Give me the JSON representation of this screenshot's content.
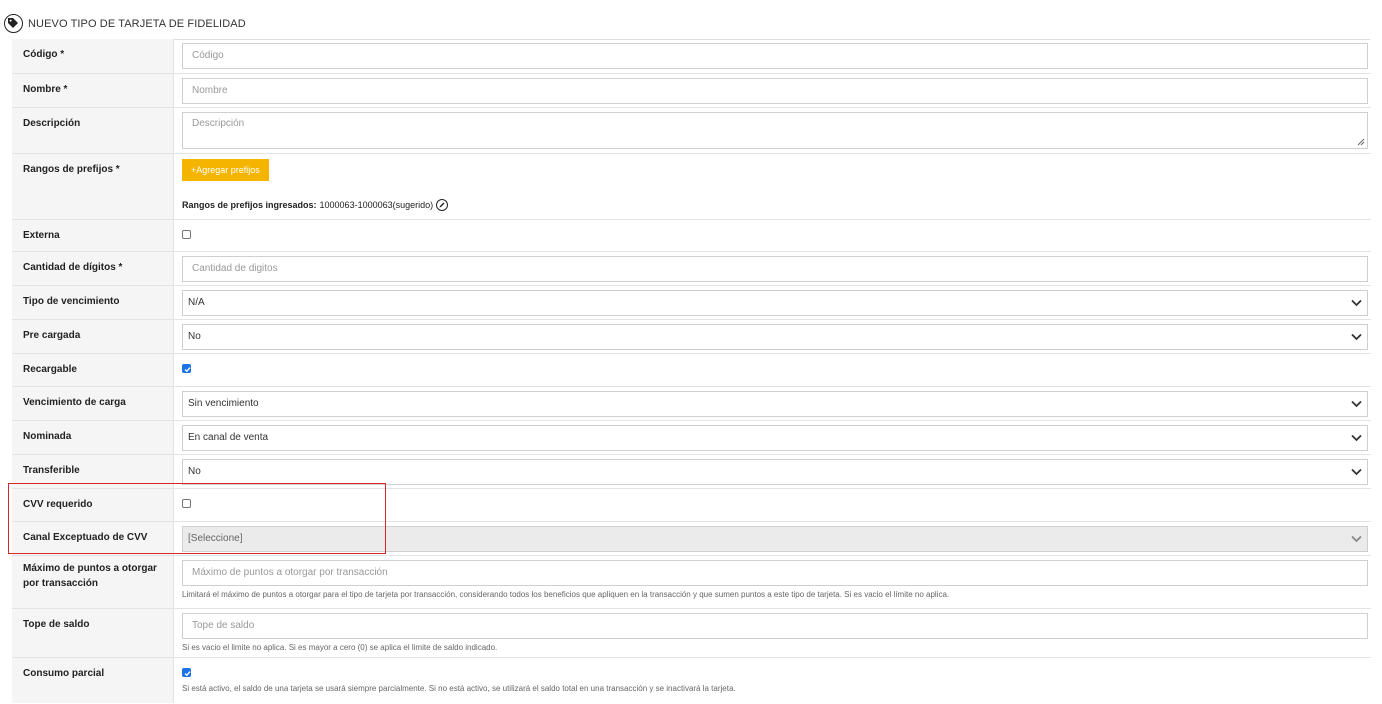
{
  "header": {
    "title": "NUEVO TIPO DE TARJETA DE FIDELIDAD",
    "icon": "tag-icon"
  },
  "form": {
    "codigo": {
      "label": "Código *",
      "placeholder": "Código"
    },
    "nombre": {
      "label": "Nombre *",
      "placeholder": "Nombre"
    },
    "descripcion": {
      "label": "Descripción",
      "placeholder": "Descripción"
    },
    "rangos": {
      "label": "Rangos de prefijos *",
      "button": "+Agregar prefijos",
      "ingresados_label": "Rangos de prefijos ingresados:",
      "ingresados_value": "1000063-1000063(sugerido)"
    },
    "externa": {
      "label": "Externa",
      "checked": false
    },
    "cantidad_digitos": {
      "label": "Cantidad de dígitos *",
      "placeholder": "Cantidad de digitos"
    },
    "tipo_vencimiento": {
      "label": "Tipo de vencimiento",
      "value": "N/A"
    },
    "pre_cargada": {
      "label": "Pre cargada",
      "value": "No"
    },
    "recargable": {
      "label": "Recargable",
      "checked": true
    },
    "vencimiento_carga": {
      "label": "Vencimiento de carga",
      "value": "Sin vencimiento"
    },
    "nominada": {
      "label": "Nominada",
      "value": "En canal de venta"
    },
    "transferible": {
      "label": "Transferible",
      "value": "No"
    },
    "cvv_requerido": {
      "label": "CVV requerido",
      "checked": false
    },
    "canal_exceptuado": {
      "label": "Canal Exceptuado de CVV",
      "value": "[Seleccione]"
    },
    "max_puntos": {
      "label": "Máximo de puntos a otorgar por transacción",
      "placeholder": "Máximo de puntos a otorgar por transacción",
      "help": "Limitará el máximo de puntos a otorgar para el tipo de tarjeta por transacción, considerando todos los beneficios que apliquen en la transacción y que sumen puntos a este tipo de tarjeta. Si es vacio el límite no aplica."
    },
    "tope_saldo": {
      "label": "Tope de saldo",
      "placeholder": "Tope de saldo",
      "help": "Si es vacio el limite no aplica. Si es mayor a cero (0) se aplica el limite de saldo indicado."
    },
    "consumo_parcial": {
      "label": "Consumo parcial",
      "checked": true,
      "help": "Si está activo, el saldo de una tarjeta se usará siempre parcialmente. Si no está activo, se utilizará el saldo total en una transacción y se inactivará la tarjeta."
    }
  },
  "colors": {
    "accent_button": "#f5b400",
    "highlight": "#d9262b",
    "checkbox": "#1a73e8"
  }
}
